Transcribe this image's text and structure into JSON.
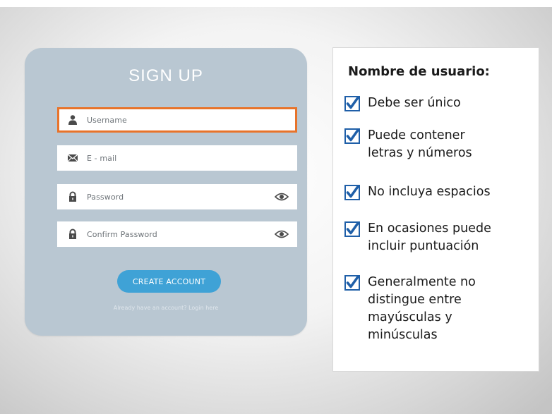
{
  "signup": {
    "title": "SIGN UP",
    "fields": {
      "username": {
        "placeholder": "Username",
        "icon": "user-icon",
        "active": true
      },
      "email": {
        "placeholder": "E - mail",
        "icon": "envelope-icon"
      },
      "password": {
        "placeholder": "Password",
        "icon": "lock-icon",
        "toggle_icon": "eye-icon"
      },
      "confirm_password": {
        "placeholder": "Confirm Password",
        "icon": "lock-icon",
        "toggle_icon": "eye-icon"
      }
    },
    "create_button": "CREATE ACCOUNT",
    "login_link": "Already have an account? Login here"
  },
  "requirements": {
    "title": "Nombre de usuario:",
    "items": [
      "Debe ser único",
      "Puede contener\nletras y números",
      "No incluya espacios",
      "En ocasiones puede\nincluir puntuación",
      "Generalmente no\ndistingue entre\nmayúsculas y\nminúsculas"
    ]
  },
  "colors": {
    "card": "#b9c7d2",
    "active_border": "#e8732a",
    "button": "#3fa2d6",
    "checkbox": "#1f5fa8"
  }
}
